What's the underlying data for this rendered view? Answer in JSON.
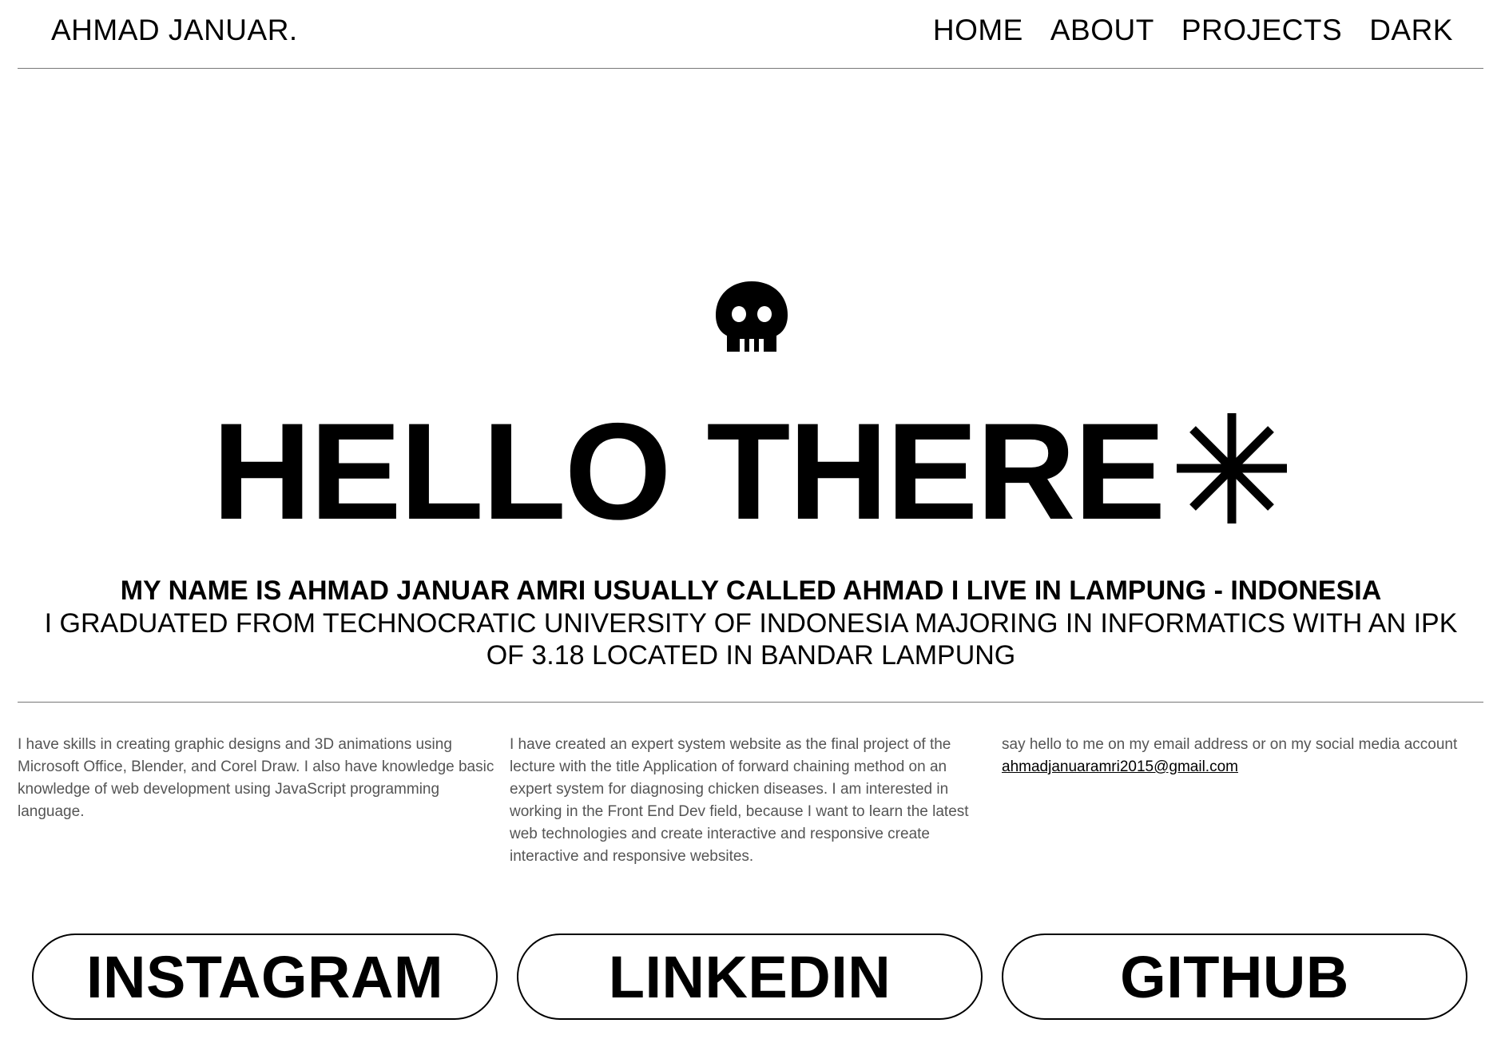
{
  "nav": {
    "brand": "AHMAD JANUAR.",
    "links": [
      "HOME",
      "ABOUT",
      "PROJECTS",
      "DARK"
    ]
  },
  "hero": {
    "icon": "skull-icon",
    "title": "HELLO THERE",
    "title_icon": "asterisk-icon"
  },
  "intro": {
    "line1": "MY NAME IS AHMAD JANUAR AMRI USUALLY CALLED AHMAD I LIVE IN LAMPUNG - INDONESIA",
    "line2": "I GRADUATED FROM TECHNOCRATIC UNIVERSITY OF INDONESIA MAJORING IN INFORMATICS WITH AN IPK OF 3.18 LOCATED IN BANDAR LAMPUNG"
  },
  "columns": {
    "skills": "I have skills in creating graphic designs and 3D animations using Microsoft Office, Blender, and Corel Draw. I also have knowledge basic knowledge of web development using JavaScript programming language.",
    "project": "I have created an expert system website as the final project of the lecture with the title Application of forward chaining method on an expert system for diagnosing chicken diseases. I am interested in working in the Front End Dev field, because I want to learn the latest web technologies and create interactive and responsive create interactive and responsive websites.",
    "contact_text": "say hello to me on my email address or on my social media account ",
    "email": "ahmadjanuaramri2015@gmail.com"
  },
  "social": [
    "INSTAGRAM",
    "LINKEDIN",
    "GITHUB"
  ],
  "colors": {
    "background": "#ffffff",
    "text": "#000000",
    "muted_text": "#555555",
    "divider": "#777777"
  }
}
